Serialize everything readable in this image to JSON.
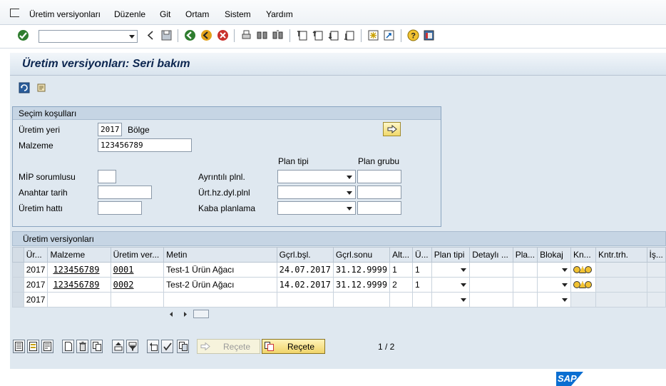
{
  "menu": {
    "items": [
      "Üretim versiyonları",
      "Düzenle",
      "Git",
      "Ortam",
      "Sistem",
      "Yardım"
    ]
  },
  "toolbar": {
    "command_field_value": "",
    "icons": [
      "enter-check-icon",
      "back-icon",
      "save-icon",
      "back-green-icon",
      "exit-icon",
      "cancel-icon",
      "print-icon",
      "find-icon",
      "find-next-icon",
      "first-page-icon",
      "previous-page-icon",
      "next-page-icon",
      "last-page-icon",
      "new-session-icon",
      "shortcut-icon",
      "help-icon",
      "customize-layout-icon"
    ]
  },
  "page": {
    "title": "Üretim versiyonları: Seri bakım"
  },
  "selection": {
    "group_title": "Seçim koşulları",
    "plant_label": "Üretim yeri",
    "plant_value": "2017",
    "plant_suffix": "Bölge",
    "material_label": "Malzeme",
    "material_value": "123456789",
    "mrp_controller_label": "MİP sorumlusu",
    "mrp_controller_value": "",
    "key_date_label": "Anahtar tarih",
    "key_date_value": "",
    "production_line_label": "Üretim hattı",
    "production_line_value": "",
    "plan_type_header": "Plan tipi",
    "plan_group_header": "Plan grubu",
    "detailed_planning_label": "Ayrıntılı plnl.",
    "rate_based_planning_label": "Ürt.hz.dyl.plnl",
    "rough_cut_planning_label": "Kaba planlama"
  },
  "versions": {
    "group_title": "Üretim versiyonları",
    "columns": [
      "Ür...",
      "Malzeme",
      "Üretim ver...",
      "Metin",
      "Gçrl.bşl.",
      "Gçrl.sonu",
      "Alt...",
      "Ü...",
      "Plan tipi",
      "Detaylı ...",
      "Pla...",
      "Blokaj",
      "Kn...",
      "Kntr.trh.",
      "İş..."
    ],
    "rows": [
      {
        "plant": "2017",
        "material": "123456789",
        "version": "0001",
        "text": "Test-1 Ürün Ağacı",
        "valid_from": "24.07.2017",
        "valid_to": "31.12.9999",
        "alt": "1",
        "usage": "1",
        "lights": [
          "yellow",
          "yellow",
          "yellow"
        ]
      },
      {
        "plant": "2017",
        "material": "123456789",
        "version": "0002",
        "text": "Test-2 Ürün Ağacı",
        "valid_from": "14.02.2017",
        "valid_to": "31.12.9999",
        "alt": "2",
        "usage": "1",
        "lights": [
          "yellow",
          "yellow",
          "yellow"
        ]
      },
      {
        "plant": "2017",
        "material": "",
        "version": "",
        "text": "",
        "valid_from": "",
        "valid_to": "",
        "alt": "",
        "usage": "",
        "lights": []
      }
    ]
  },
  "bottom": {
    "recipe_button_disabled": "Reçete",
    "recipe_button": "Reçete",
    "page_indicator": "1 / 2"
  },
  "brand": {
    "logo_text": "SAP",
    "colors": {
      "accent": "#0a6ed1",
      "title": "#0c2650",
      "panel": "#dfe8f0"
    }
  }
}
